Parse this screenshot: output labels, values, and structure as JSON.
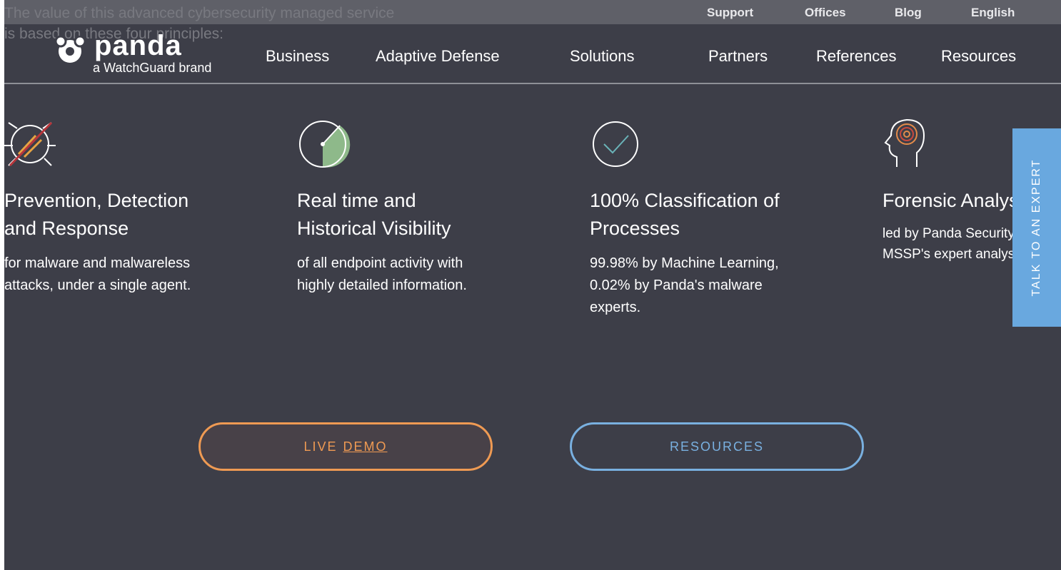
{
  "header": {
    "ghost_text_line1": "The value of this advanced cybersecurity managed service",
    "ghost_text_line2": "is based on these four principles:",
    "util_links": [
      "Support",
      "Offices",
      "Blog",
      "English"
    ],
    "logo": {
      "wordmark": "panda",
      "brand_line": "a WatchGuard brand"
    },
    "nav": [
      "Business",
      "Adaptive Defense",
      "Solutions",
      "Partners",
      "References",
      "Resources"
    ]
  },
  "principles": [
    {
      "icon": "bug-blocked-icon",
      "title_line1": "Prevention, Detection",
      "title_line2": "and Response",
      "desc_line1": "for malware and malwareless",
      "desc_line2": "attacks, under a single agent.",
      "desc_line3": ""
    },
    {
      "icon": "clock-visibility-icon",
      "title_line1": "Real time and",
      "title_line2": "Historical Visibility",
      "desc_line1": "of all endpoint activity with",
      "desc_line2": "highly detailed information.",
      "desc_line3": ""
    },
    {
      "icon": "check-circle-icon",
      "title_line1": "100% Classification of",
      "title_line2": "Processes",
      "desc_line1": "99.98% by Machine Learning,",
      "desc_line2": "0.02% by Panda's malware",
      "desc_line3": "experts."
    },
    {
      "icon": "head-target-icon",
      "title_line1": "Forensic Analysis",
      "title_line2": "",
      "desc_line1": "led by Panda Security",
      "desc_line2": "MSSP's expert analysts",
      "desc_line3": ""
    }
  ],
  "cta": {
    "demo_prefix": "LIVE",
    "demo_link": "DEMO",
    "resources": "RESOURCES"
  },
  "side_tab": {
    "label": "TALK TO AN EXPERT"
  },
  "colors": {
    "background": "#3d3e48",
    "topbar": "#5f6068",
    "demo_accent": "#ef9a53",
    "resources_accent": "#79b0e0",
    "side_tab": "#69a8df"
  }
}
